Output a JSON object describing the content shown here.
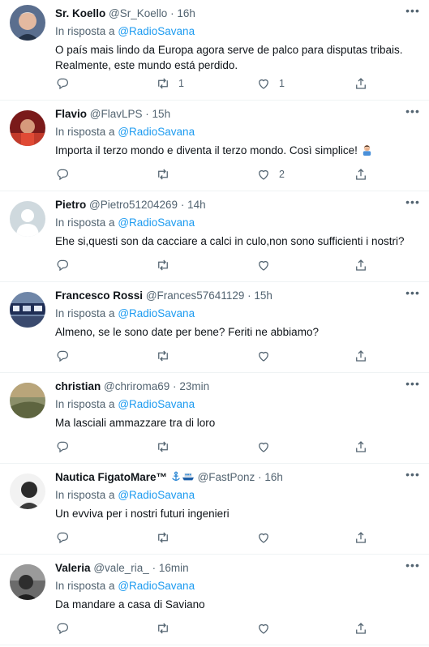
{
  "reply_prefix": "In risposta a",
  "tweets": [
    {
      "name": "Sr. Koello",
      "handle": "@Sr_Koello",
      "time": "16h",
      "mention": "@RadioSavana",
      "text": "O país mais lindo da Europa agora serve de palco para disputas tribais. Realmente, este mundo está perdido.",
      "replies": "",
      "retweets": "1",
      "likes": "1"
    },
    {
      "name": "Flavio",
      "handle": "@FlavLPS",
      "time": "15h",
      "mention": "@RadioSavana",
      "text": "Importa il terzo mondo e diventa il terzo mondo. Così simplice!",
      "replies": "",
      "retweets": "",
      "likes": "2"
    },
    {
      "name": "Pietro",
      "handle": "@Pietro51204269",
      "time": "14h",
      "mention": "@RadioSavana",
      "text": "Ehe si,questi son da cacciare a calci in culo,non sono sufficienti i nostri?",
      "replies": "",
      "retweets": "",
      "likes": ""
    },
    {
      "name": "Francesco Rossi",
      "handle": "@Frances57641129",
      "time": "15h",
      "mention": "@RadioSavana",
      "text": "Almeno, se le sono date per bene? Feriti ne abbiamo?",
      "replies": "",
      "retweets": "",
      "likes": ""
    },
    {
      "name": "christian",
      "handle": "@chriroma69",
      "time": "23min",
      "mention": "@RadioSavana",
      "text": "Ma lasciali ammazzare tra di loro",
      "replies": "",
      "retweets": "",
      "likes": ""
    },
    {
      "name": "Nautica FigatoMare™",
      "handle": "@FastPonz",
      "time": "16h",
      "mention": "@RadioSavana",
      "text": "Un evviva per i nostri futuri ingenieri",
      "replies": "",
      "retweets": "",
      "likes": ""
    },
    {
      "name": "Valeria",
      "handle": "@vale_ria_",
      "time": "16min",
      "mention": "@RadioSavana",
      "text": "Da mandare a casa di Saviano",
      "replies": "",
      "retweets": "",
      "likes": ""
    }
  ],
  "icons": {
    "reply": "reply-icon",
    "retweet": "retweet-icon",
    "like": "heart-icon",
    "share": "share-icon",
    "more": "more-icon"
  },
  "colors": {
    "link": "#1d9bf0",
    "secondary": "#536471",
    "text": "#0f1419",
    "divider": "#eff3f4"
  }
}
